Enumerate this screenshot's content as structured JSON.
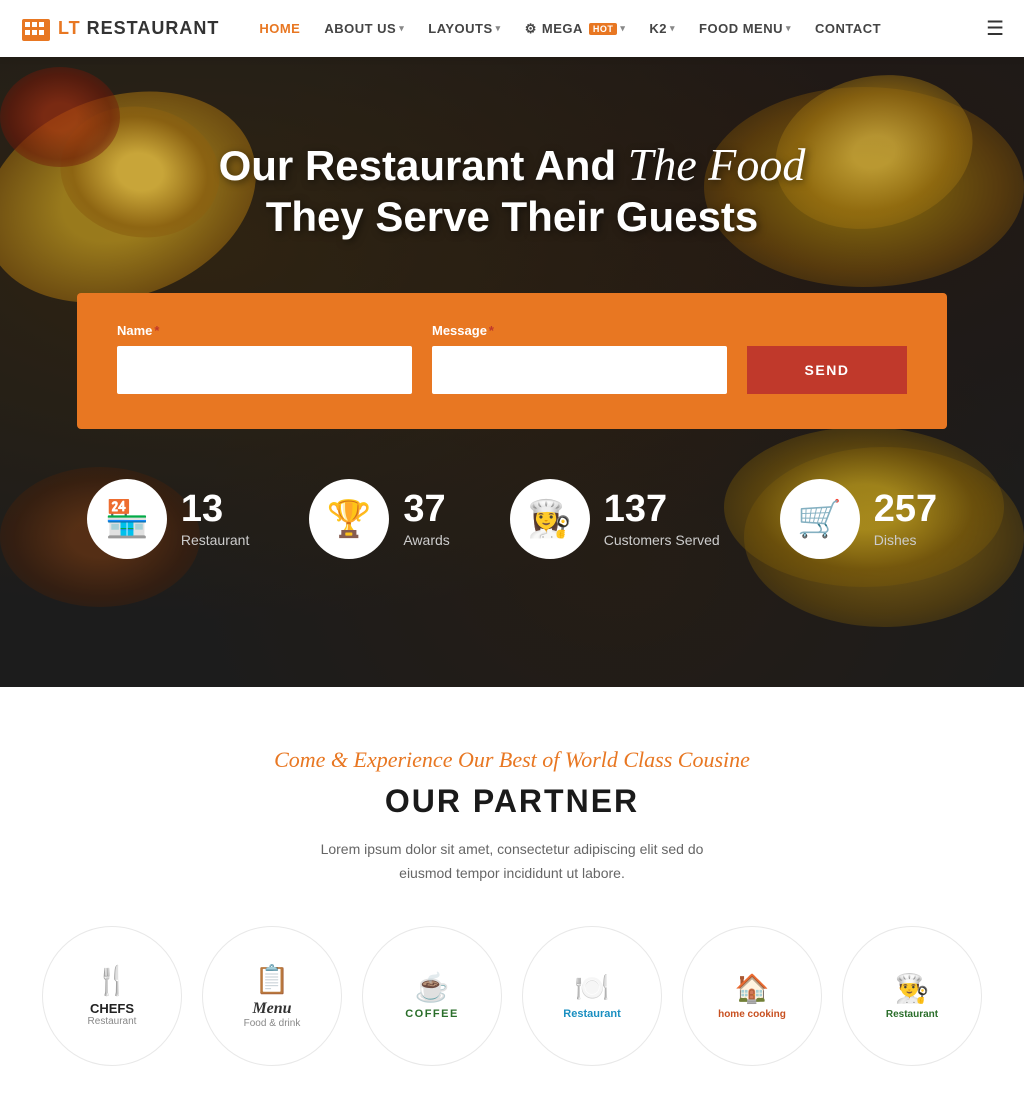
{
  "navbar": {
    "logo_lt": "LT",
    "logo_restaurant": " RESTAURANT",
    "nav_items": [
      {
        "label": "HOME",
        "active": true,
        "has_dropdown": false,
        "id": "home"
      },
      {
        "label": "ABOUT US",
        "active": false,
        "has_dropdown": true,
        "id": "about"
      },
      {
        "label": "LAYOUTS",
        "active": false,
        "has_dropdown": true,
        "id": "layouts"
      },
      {
        "label": "MEGA",
        "active": false,
        "has_dropdown": true,
        "id": "mega",
        "badge": "HOT"
      },
      {
        "label": "K2",
        "active": false,
        "has_dropdown": true,
        "id": "k2"
      },
      {
        "label": "FOOD MENU",
        "active": false,
        "has_dropdown": true,
        "id": "food-menu"
      },
      {
        "label": "CONTACT",
        "active": false,
        "has_dropdown": false,
        "id": "contact"
      }
    ]
  },
  "hero": {
    "title_part1": "Our Restaurant And ",
    "title_cursive": "The Food",
    "title_part2": "They Serve Their Guests"
  },
  "form": {
    "name_label": "Name",
    "name_required": "*",
    "name_placeholder": "",
    "message_label": "Message",
    "message_required": "*",
    "message_placeholder": "",
    "send_button": "SEND"
  },
  "stats": [
    {
      "number": "13",
      "label": "Restaurant",
      "emoji": "🏪"
    },
    {
      "number": "37",
      "label": "Awards",
      "emoji": "🏆"
    },
    {
      "number": "137",
      "label": "Customers Served",
      "emoji": "👩‍🍳"
    },
    {
      "number": "257",
      "label": "Dishes",
      "emoji": "🛒"
    }
  ],
  "partner": {
    "subtitle": "Come & Experience Our Best of World Class Cousine",
    "title": "OUR PARTNER",
    "description": "Lorem ipsum dolor sit amet, consectetur adipiscing elit sed do eiusmod tempor incididunt ut labore.",
    "logos": [
      {
        "name": "CHEFS",
        "sub": "Restaurant",
        "emoji": "🍴",
        "style": "chefs"
      },
      {
        "name": "Menu",
        "sub": "Food & drink",
        "emoji": "📋",
        "style": "menu"
      },
      {
        "name": "COFFEE",
        "sub": "",
        "emoji": "☕",
        "style": "coffee"
      },
      {
        "name": "Restaurant",
        "sub": "",
        "emoji": "🍽️",
        "style": "restaurant"
      },
      {
        "name": "home cooking",
        "sub": "",
        "emoji": "🏠",
        "style": "homecooking"
      },
      {
        "name": "Restaurant",
        "sub": "",
        "emoji": "👨‍🍳",
        "style": "rest2"
      }
    ]
  }
}
